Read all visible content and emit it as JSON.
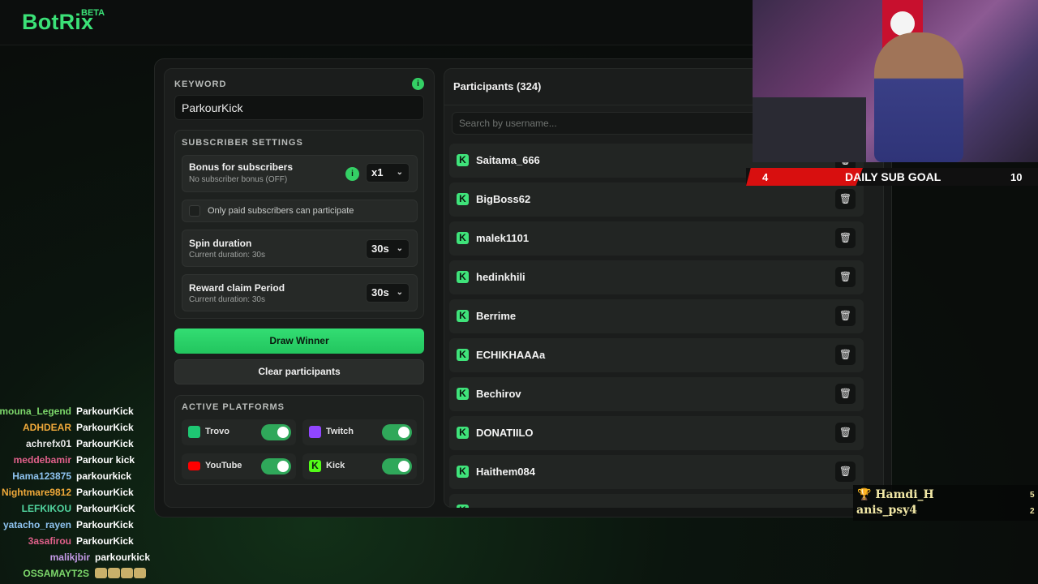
{
  "brand": {
    "name": "BotRix",
    "badge": "BETA",
    "accent": "#3be177"
  },
  "keyword": {
    "label": "KEYWORD",
    "value": "ParkourKick"
  },
  "subscriber_settings": {
    "title": "SUBSCRIBER SETTINGS",
    "bonus": {
      "title": "Bonus for subscribers",
      "subtitle": "No subscriber bonus (OFF)",
      "value": "x1"
    },
    "paid_only": {
      "label": "Only paid subscribers can participate",
      "checked": false
    },
    "spin": {
      "title": "Spin duration",
      "subtitle": "Current duration: 30s",
      "value": "30s"
    },
    "reward": {
      "title": "Reward claim Period",
      "subtitle": "Current duration: 30s",
      "value": "30s"
    }
  },
  "actions": {
    "draw": "Draw Winner",
    "clear": "Clear participants"
  },
  "platforms": {
    "title": "ACTIVE PLATFORMS",
    "items": [
      {
        "name": "Trovo",
        "enabled": true,
        "color": "#1ec773"
      },
      {
        "name": "Twitch",
        "enabled": true,
        "color": "#9146ff"
      },
      {
        "name": "YouTube",
        "enabled": true,
        "color": "#ff0000"
      },
      {
        "name": "Kick",
        "enabled": true,
        "color": "#53fc18"
      }
    ]
  },
  "participants": {
    "title": "Participants (324)",
    "search_placeholder": "Search by username...",
    "list": [
      "Saitama_666",
      "BigBoss62",
      "malek1101",
      "hedinkhili",
      "Berrime",
      "ECHIKHAAAa",
      "Bechirov",
      "DONATIILO",
      "Haithem084"
    ]
  },
  "sub_goal": {
    "current": "4",
    "label": "DAILY SUB GOAL",
    "target": "10",
    "progress": 0.4
  },
  "leaderboard": [
    {
      "name": "Hamdi_H",
      "score": "5"
    },
    {
      "name": "anis_psy4",
      "score": "2"
    }
  ],
  "chat": [
    {
      "user": "amouna_Legend",
      "message": "ParkourKick",
      "color": "#7dd86b"
    },
    {
      "user": "ADHDEAR",
      "message": "ParkourKick",
      "color": "#f0a93a"
    },
    {
      "user": "achrefx01",
      "message": "ParkourKick",
      "color": "#e6e6e6"
    },
    {
      "user": "meddebamir",
      "message": "Parkour kick",
      "color": "#e0608a"
    },
    {
      "user": "Hama123875",
      "message": "parkourkick",
      "color": "#8ec3f0"
    },
    {
      "user": "Nightmare9812",
      "message": "ParkourKick",
      "color": "#f0a93a"
    },
    {
      "user": "LEFKIKOU",
      "message": "ParkourKicK",
      "color": "#52d6a0"
    },
    {
      "user": "yatacho_rayen",
      "message": "ParkourKick",
      "color": "#8ec3f0"
    },
    {
      "user": "3asafirou",
      "message": "ParkourKick",
      "color": "#e0608a"
    },
    {
      "user": "malikjbir",
      "message": "parkourkick",
      "color": "#c59ae8"
    },
    {
      "user": "OSSAMAYT2S",
      "message": "",
      "color": "#7dd86b"
    }
  ]
}
